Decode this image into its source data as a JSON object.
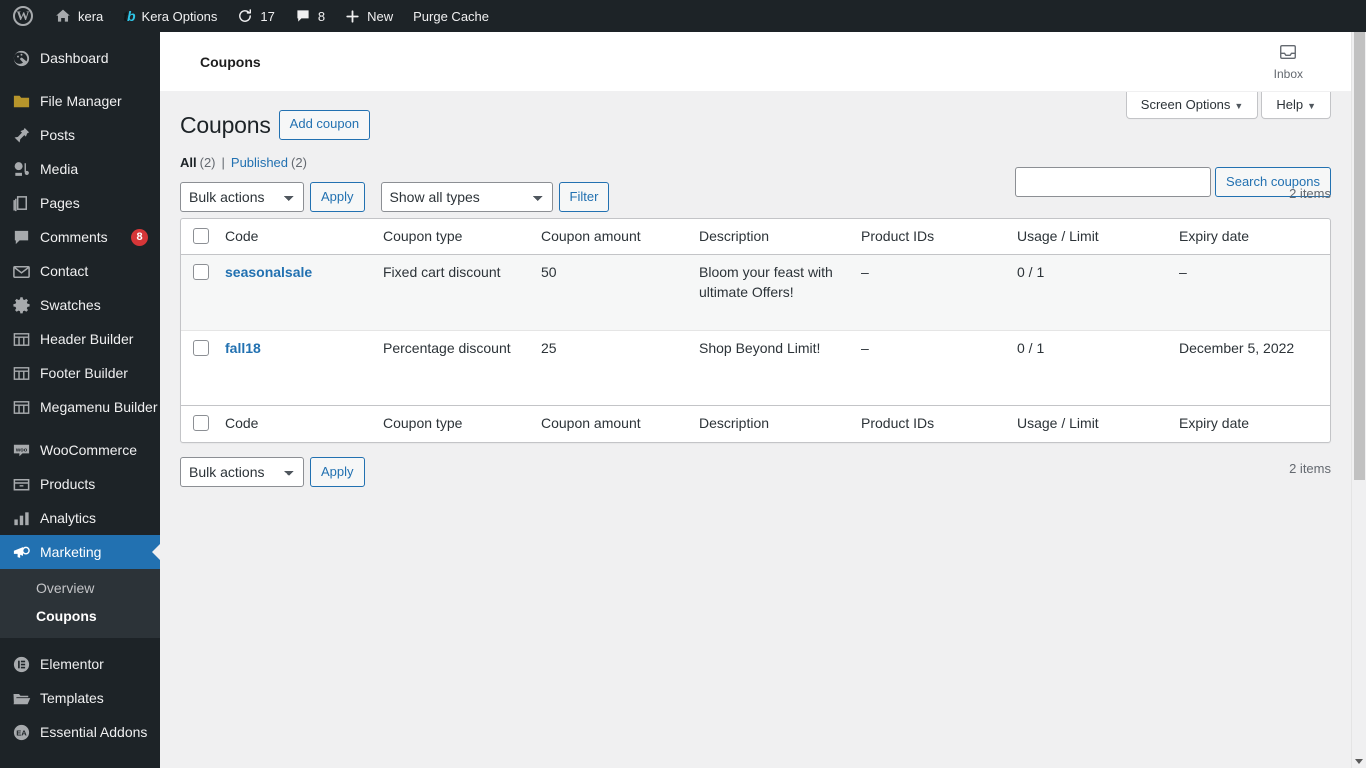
{
  "adminbar": {
    "items": [
      {
        "icon": "wordpress-logo-icon",
        "label": ""
      },
      {
        "icon": "home-icon",
        "label": "kera"
      },
      {
        "icon": "templatebox-logo-icon",
        "label": "Kera Options"
      },
      {
        "icon": "update-icon",
        "label": "17"
      },
      {
        "icon": "comment-bubble-icon",
        "label": "8"
      },
      {
        "icon": "plus-icon",
        "label": "New"
      },
      {
        "icon": "",
        "label": "Purge Cache"
      }
    ]
  },
  "sidebar": {
    "items": [
      {
        "label": "Dashboard",
        "icon": "dashboard-icon",
        "badge": ""
      },
      {
        "label": "File Manager",
        "icon": "folder-icon",
        "badge": ""
      },
      {
        "label": "Posts",
        "icon": "pin-icon",
        "badge": ""
      },
      {
        "label": "Media",
        "icon": "media-icon",
        "badge": ""
      },
      {
        "label": "Pages",
        "icon": "pages-icon",
        "badge": ""
      },
      {
        "label": "Comments",
        "icon": "comment-icon",
        "badge": "8"
      },
      {
        "label": "Contact",
        "icon": "envelope-icon",
        "badge": ""
      },
      {
        "label": "Swatches",
        "icon": "gear-icon",
        "badge": ""
      },
      {
        "label": "Header Builder",
        "icon": "layout-icon",
        "badge": ""
      },
      {
        "label": "Footer Builder",
        "icon": "layout-icon",
        "badge": ""
      },
      {
        "label": "Megamenu Builder",
        "icon": "layout-icon",
        "badge": ""
      },
      {
        "label": "WooCommerce",
        "icon": "woocommerce-icon",
        "badge": ""
      },
      {
        "label": "Products",
        "icon": "products-icon",
        "badge": ""
      },
      {
        "label": "Analytics",
        "icon": "analytics-icon",
        "badge": ""
      },
      {
        "label": "Marketing",
        "icon": "megaphone-icon",
        "badge": "",
        "current": true
      },
      {
        "label": "Elementor",
        "icon": "elementor-icon",
        "badge": ""
      },
      {
        "label": "Templates",
        "icon": "open-folder-icon",
        "badge": ""
      },
      {
        "label": "Essential Addons",
        "icon": "essential-addons-icon",
        "badge": ""
      }
    ],
    "submenu": [
      {
        "label": "Overview",
        "current": false
      },
      {
        "label": "Coupons",
        "current": true
      }
    ],
    "accent_color": "#2271b1",
    "background_color": "#1d2327"
  },
  "woo_header": {
    "title": "Coupons",
    "inbox_label": "Inbox",
    "inbox_icon": "inbox-icon"
  },
  "screen_meta": {
    "screen_options": "Screen Options",
    "help": "Help",
    "caret": "▼"
  },
  "page": {
    "title": "Coupons",
    "add_button": "Add coupon"
  },
  "filters": {
    "all_label": "All",
    "all_count": "(2)",
    "divider": "|",
    "published_label": "Published",
    "published_count": "(2)"
  },
  "search": {
    "value": "",
    "placeholder": "",
    "button": "Search coupons"
  },
  "tablenav_top": {
    "bulk_actions": "Bulk actions",
    "apply": "Apply",
    "types": "Show all types",
    "filter": "Filter",
    "items_count": "2 items"
  },
  "tablenav_bottom": {
    "bulk_actions": "Bulk actions",
    "apply": "Apply",
    "items_count": "2 items"
  },
  "table": {
    "columns": [
      "Code",
      "Coupon type",
      "Coupon amount",
      "Description",
      "Product IDs",
      "Usage / Limit",
      "Expiry date"
    ],
    "rows": [
      {
        "code": "seasonalsale",
        "type": "Fixed cart discount",
        "amount": "50",
        "description": "Bloom your feast with ultimate Offers!",
        "product_ids": "–",
        "usage": "0 / 1",
        "expiry": "–"
      },
      {
        "code": "fall18",
        "type": "Percentage discount",
        "amount": "25",
        "description": "Shop Beyond Limit!",
        "product_ids": "–",
        "usage": "0 / 1",
        "expiry": "December 5, 2022"
      }
    ]
  }
}
